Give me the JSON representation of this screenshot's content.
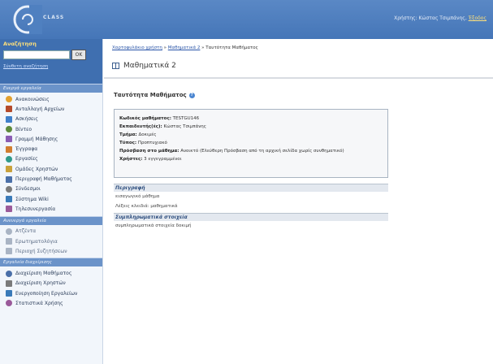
{
  "header": {
    "logo_text": "CLASS",
    "user_label": "Χρήστης: Κώστας Τσιμπάνης",
    "logout_label": "Έξοδος",
    "bg_color": "#4a7bbd"
  },
  "search": {
    "title": "Αναζήτηση",
    "input_value": "",
    "ok_label": "OK",
    "advanced_label": "Σύνθετη αναζήτηση"
  },
  "sidebar": {
    "sections": [
      {
        "title": "Ενεργά εργαλεία",
        "items": [
          {
            "label": "Ανακοινώσεις",
            "icon": "megaphone-icon"
          },
          {
            "label": "Ανταλλαγή Αρχείων",
            "icon": "file-exchange-icon"
          },
          {
            "label": "Ασκήσεις",
            "icon": "exercises-icon"
          },
          {
            "label": "Βίντεο",
            "icon": "video-icon"
          },
          {
            "label": "Γραμμή Μάθησης",
            "icon": "learning-path-icon"
          },
          {
            "label": "Έγγραφα",
            "icon": "documents-icon"
          },
          {
            "label": "Εργασίες",
            "icon": "assignments-icon"
          },
          {
            "label": "Ομάδες Χρηστών",
            "icon": "user-groups-icon"
          },
          {
            "label": "Περιγραφή Μαθήματος",
            "icon": "course-description-icon"
          },
          {
            "label": "Σύνδεσμοι",
            "icon": "links-icon"
          },
          {
            "label": "Σύστημα Wiki",
            "icon": "wiki-icon"
          },
          {
            "label": "Τηλεσυνεργασία",
            "icon": "teleconference-icon"
          }
        ]
      },
      {
        "title": "Ανενεργά εργαλεία",
        "items": [
          {
            "label": "Ατζέντα",
            "icon": "agenda-icon"
          },
          {
            "label": "Ερωτηματολόγια",
            "icon": "questionnaire-icon"
          },
          {
            "label": "Περιοχή Συζητήσεων",
            "icon": "forum-icon"
          }
        ]
      },
      {
        "title": "Εργαλεία διαχείρισης",
        "items": [
          {
            "label": "Διαχείριση Μαθήματος",
            "icon": "course-admin-icon"
          },
          {
            "label": "Διαχείριση Χρηστών",
            "icon": "user-admin-icon"
          },
          {
            "label": "Ενεργοποίηση Εργαλείων",
            "icon": "tools-activation-icon"
          },
          {
            "label": "Στατιστικά Χρήσης",
            "icon": "statistics-icon"
          }
        ]
      }
    ]
  },
  "breadcrumb": {
    "items": [
      "Χαρτοφυλάκιο χρήστη",
      "Μαθηματικά 2"
    ],
    "separator": "»",
    "current": "Ταυτότητα Μαθήματος"
  },
  "page": {
    "title": "Μαθηματικά 2",
    "section_title": "Ταυτότητα Μαθήματος"
  },
  "course_info": [
    {
      "label": "Κωδικός μαθήματος:",
      "value": "TESTGU146"
    },
    {
      "label": "Εκπαιδευτής(ές):",
      "value": "Κώστας Τσιμπάνης"
    },
    {
      "label": "Τμήμα:",
      "value": "Δοκιμές"
    },
    {
      "label": "Τύπος:",
      "value": "Προπτυχιακό"
    },
    {
      "label": "Πρόσβαση στο μάθημα:",
      "value": "Ανοικτό (Ελεύθερη Πρόσβαση από τη αρχική σελίδα χωρίς συνθηματικό)"
    },
    {
      "label": "Χρήστες:",
      "value": "3 εγγεγραμμένοι"
    }
  ],
  "description": {
    "title": "Περιγραφή",
    "text": "εισαγωγικό μάθημα",
    "keywords_label": "Λέξεις κλειδιά:",
    "keywords_value": "μαθηματικά"
  },
  "extra": {
    "title": "Συμπληρωματικά στοιχεία",
    "text": "συμπληρωματικά στοιχεία δοκιμή"
  }
}
